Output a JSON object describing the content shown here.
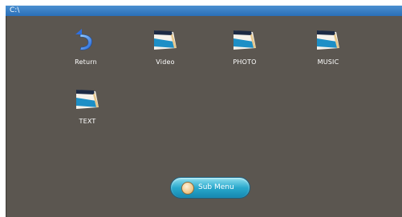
{
  "window": {
    "path": "C:\\"
  },
  "items": [
    {
      "label": "Return",
      "icon": "return-arrow-icon"
    },
    {
      "label": "Video",
      "icon": "folder-icon"
    },
    {
      "label": "PHOTO",
      "icon": "folder-icon"
    },
    {
      "label": "MUSIC",
      "icon": "folder-icon"
    },
    {
      "label": "TEXT",
      "icon": "folder-icon"
    }
  ],
  "footer": {
    "submenu_label": "Sub Menu"
  },
  "colors": {
    "titlebar": "#2a6fb8",
    "background": "#5b5650",
    "button": "#2aa9cc"
  }
}
